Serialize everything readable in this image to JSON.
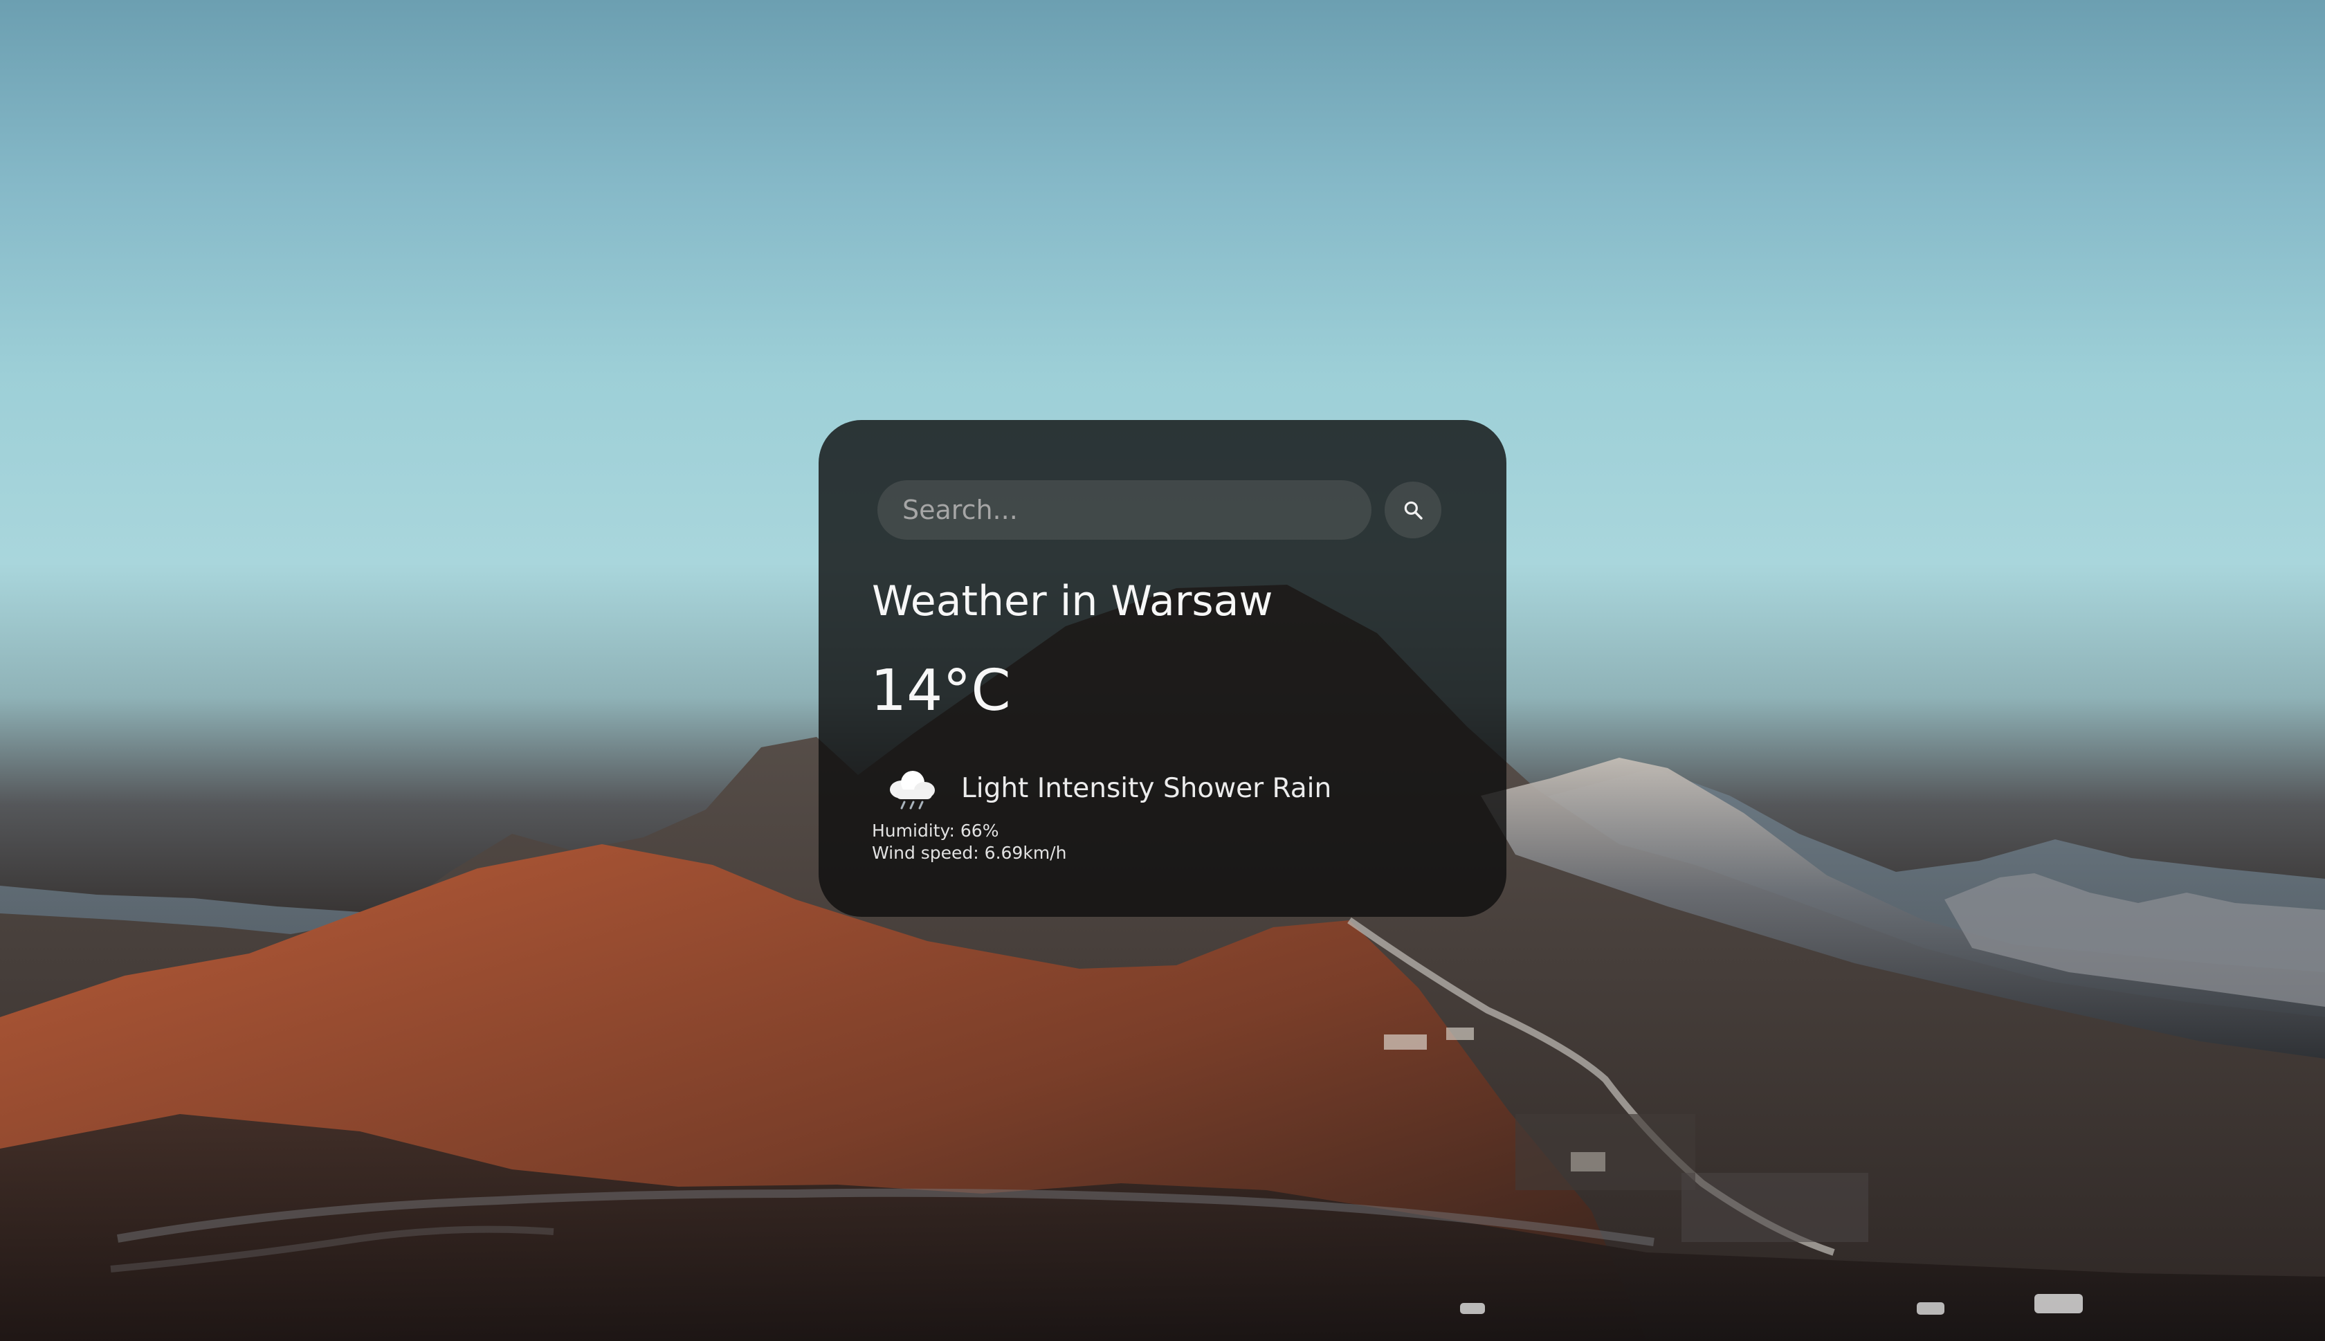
{
  "search": {
    "placeholder": "Search..."
  },
  "weather": {
    "title": "Weather in Warsaw",
    "temperature": "14°C",
    "description": "Light Intensity Shower Rain",
    "humidity": "Humidity: 66%",
    "wind": "Wind speed: 6.69km/h"
  },
  "icons": {
    "search": "search-icon",
    "condition": "cloud-rain-icon"
  },
  "colors": {
    "card": "#0e0e0e",
    "input": "#3a3a3a",
    "text": "#f5f5f5"
  }
}
